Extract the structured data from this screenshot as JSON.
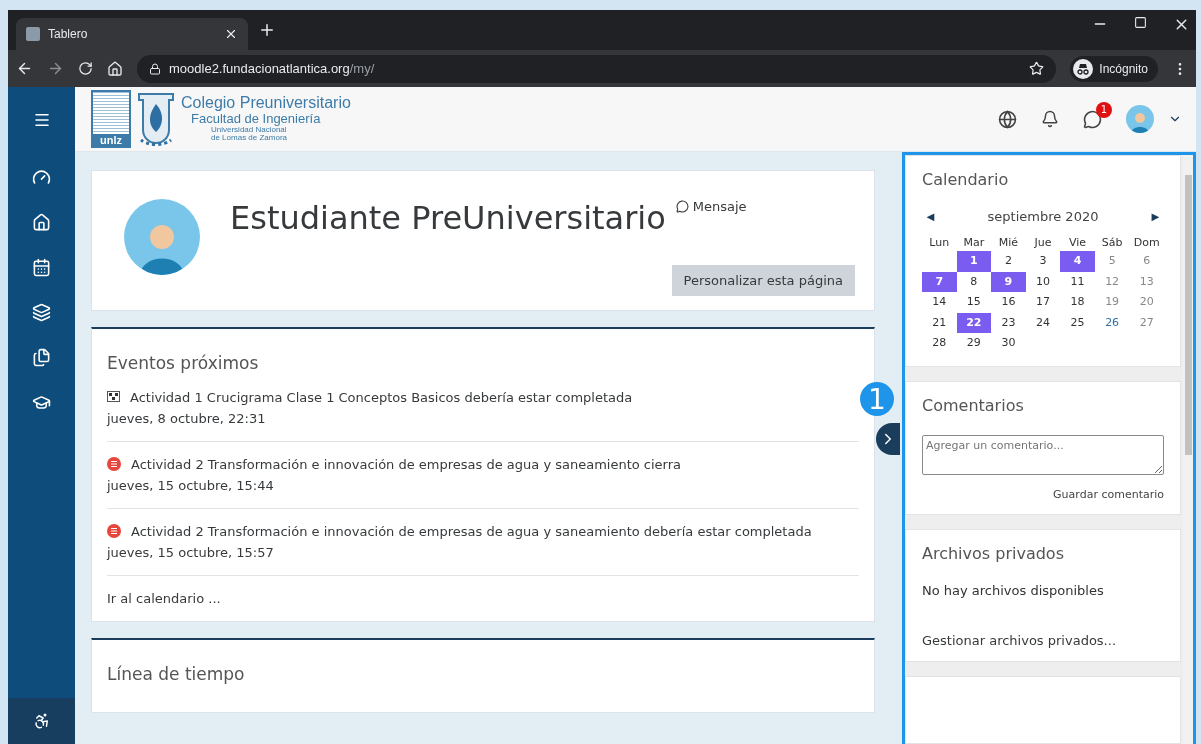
{
  "browser": {
    "tab_title": "Tablero",
    "url_host": "moodle2.fundacionatlantica.org",
    "url_path": "/my/",
    "profile_label": "Incógnito"
  },
  "header": {
    "logo": {
      "mark": "unlz",
      "title": "Colegio Preuniversitario",
      "subtitle": "Facultad de Ingeniería",
      "university_line_1": "Universidad Nacional",
      "university_line_2": "de Lomas de Zamora"
    },
    "messages_badge": "1"
  },
  "profile": {
    "name": "Estudiante PreUniversitario",
    "message_link": "Mensaje",
    "customize_button": "Personalizar esta página"
  },
  "upcoming_events": {
    "title": "Eventos próximos",
    "events": [
      {
        "kind": "crossword",
        "title": "Actividad 1 Crucigrama Clase 1 Conceptos Basicos debería estar completada",
        "date": "jueves, 8 octubre, 22:31"
      },
      {
        "kind": "assignment",
        "title": "Actividad 2 Transformación e innovación de empresas de agua y saneamiento cierra",
        "date": "jueves, 15 octubre, 15:44"
      },
      {
        "kind": "assignment",
        "title": "Actividad 2 Transformación e innovación de empresas de agua y saneamiento debería estar completada",
        "date": "jueves, 15 octubre, 15:57"
      }
    ],
    "footer_link": "Ir al calendario ..."
  },
  "timeline": {
    "title": "Línea de tiempo"
  },
  "annotation": "1",
  "calendar": {
    "title": "Calendario",
    "prev": "◄",
    "month": "septiembre 2020",
    "next": "►",
    "weekdays": [
      "Lun",
      "Mar",
      "Mié",
      "Jue",
      "Vie",
      "Sáb",
      "Dom"
    ],
    "weeks": [
      [
        {
          "day": "1",
          "event": true,
          "today": false
        },
        {
          "day": "2",
          "event": false,
          "today": false
        },
        {
          "day": "3",
          "event": false,
          "today": false
        },
        {
          "day": "4",
          "event": true,
          "today": false
        },
        {
          "day": "5",
          "event": false,
          "today": false
        },
        {
          "day": "6",
          "event": false,
          "today": false
        }
      ],
      [
        {
          "day": "7",
          "event": true,
          "today": false
        },
        {
          "day": "8",
          "event": false,
          "today": false
        },
        {
          "day": "9",
          "event": true,
          "today": false
        },
        {
          "day": "10",
          "event": false,
          "today": false
        },
        {
          "day": "11",
          "event": false,
          "today": false
        },
        {
          "day": "12",
          "event": false,
          "today": false
        },
        {
          "day": "13",
          "event": false,
          "today": false
        }
      ],
      [
        {
          "day": "14",
          "event": false,
          "today": false
        },
        {
          "day": "15",
          "event": false,
          "today": false
        },
        {
          "day": "16",
          "event": false,
          "today": false
        },
        {
          "day": "17",
          "event": false,
          "today": false
        },
        {
          "day": "18",
          "event": false,
          "today": false
        },
        {
          "day": "19",
          "event": false,
          "today": false
        },
        {
          "day": "20",
          "event": false,
          "today": false
        }
      ],
      [
        {
          "day": "21",
          "event": false,
          "today": false
        },
        {
          "day": "22",
          "event": true,
          "today": false
        },
        {
          "day": "23",
          "event": false,
          "today": false
        },
        {
          "day": "24",
          "event": false,
          "today": false
        },
        {
          "day": "25",
          "event": false,
          "today": false
        },
        {
          "day": "26",
          "event": false,
          "today": true
        },
        {
          "day": "27",
          "event": false,
          "today": false
        }
      ],
      [
        {
          "day": "28",
          "event": false,
          "today": false
        },
        {
          "day": "29",
          "event": false,
          "today": false
        },
        {
          "day": "30",
          "event": false,
          "today": false
        }
      ]
    ]
  },
  "comments": {
    "title": "Comentarios",
    "placeholder": "Agregar un comentario...",
    "save_link": "Guardar comentario"
  },
  "private_files": {
    "title": "Archivos privados",
    "empty_text": "No hay archivos disponibles",
    "manage_link": "Gestionar archivos privados..."
  }
}
